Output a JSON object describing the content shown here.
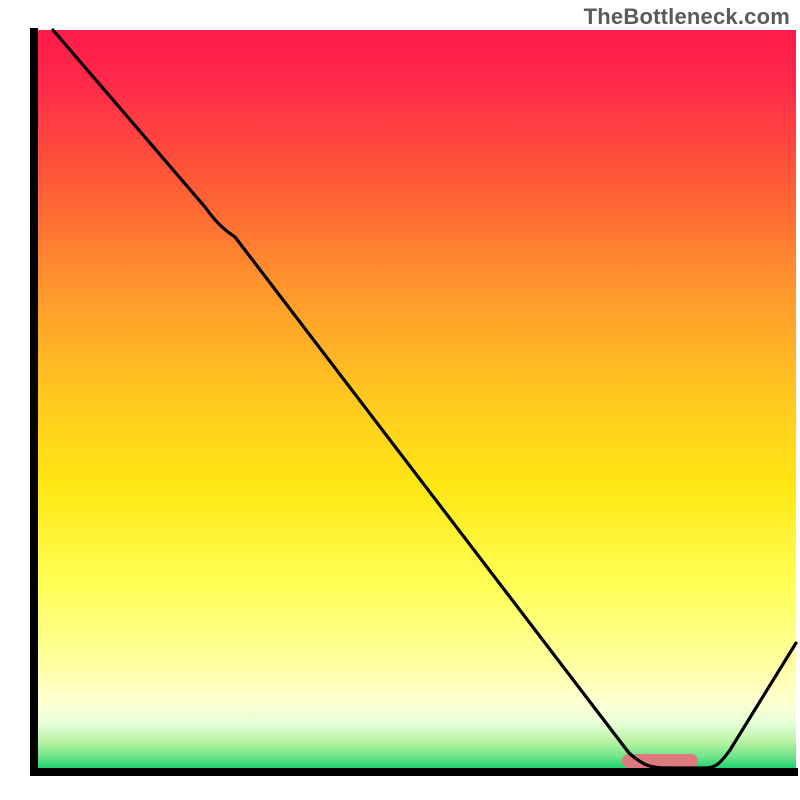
{
  "watermark": "TheBottleneck.com",
  "chart_data": {
    "type": "line",
    "title": "",
    "xlabel": "",
    "ylabel": "",
    "xlim": [
      0,
      100
    ],
    "ylim": [
      0,
      100
    ],
    "grid": false,
    "legend": false,
    "annotations": [],
    "axes": {
      "left": {
        "visible": true,
        "ticks": []
      },
      "bottom": {
        "visible": true,
        "ticks": []
      }
    },
    "gradient_bg": {
      "0.00": "#ff1b4b",
      "0.35": "#ff8e2e",
      "0.55": "#ffd916",
      "0.78": "#ffff66",
      "0.90": "#ffffb0",
      "0.96": "#b8f59f",
      "1.00": "#1dd36f"
    },
    "series": [
      {
        "name": "curve",
        "color": "#000000",
        "x": [
          2,
          22,
          26,
          78,
          83,
          88,
          100
        ],
        "y": [
          100,
          76,
          72,
          2,
          0,
          0,
          17
        ]
      }
    ],
    "highlight_pill": {
      "color": "#dd7a7e",
      "center_x": 82,
      "center_y": 0.6,
      "width": 10,
      "height": 2
    }
  }
}
